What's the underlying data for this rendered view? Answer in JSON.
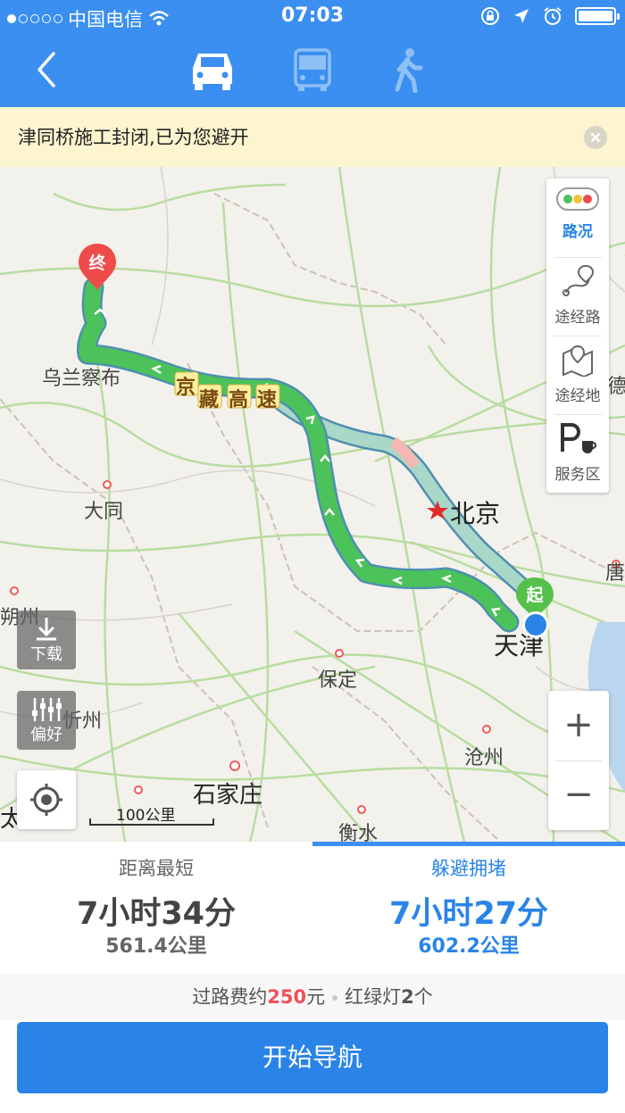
{
  "status_bar": {
    "carrier": "中国电信",
    "time": "07:03"
  },
  "navbar": {
    "modes": [
      "car-icon",
      "bus-icon",
      "walk-icon"
    ],
    "selected_mode": "car"
  },
  "notice": {
    "text": "津同桥施工封闭,已为您避开"
  },
  "map": {
    "cities": {
      "wulanchabu": "乌兰察布",
      "datong": "大同",
      "beijing": "北京",
      "tianjin": "天津",
      "baoding": "保定",
      "cangzhou": "沧州",
      "shijiazhuang": "石家庄",
      "hengshui": "衡水",
      "shuozhou": "朔州",
      "xinzhou": "忻州",
      "tangshan": "唐",
      "dezhou": "德",
      "taiyuan": "太"
    },
    "highway_label": [
      "京",
      "藏",
      "高",
      "速"
    ],
    "start_label": "起",
    "end_label": "终",
    "sidebar": {
      "traffic": "路况",
      "via_road": "途经路",
      "via_place": "途经地",
      "service": "服务区"
    },
    "download": "下载",
    "preference": "偏好",
    "scale": "100公里",
    "zoom_in": "+",
    "zoom_out": "−"
  },
  "routes": [
    {
      "name": "距离最短",
      "time": "7小时34分",
      "distance": "561.4公里",
      "selected": false
    },
    {
      "name": "躲避拥堵",
      "time": "7小时27分",
      "distance": "602.2公里",
      "selected": true
    }
  ],
  "fees": {
    "toll_prefix": "过路费约",
    "toll_value": "250",
    "toll_suffix": "元",
    "lights_prefix": "红绿灯",
    "lights_value": "2",
    "lights_suffix": "个"
  },
  "start_button": "开始导航",
  "colors": {
    "brand_blue": "#3a8ff0",
    "route_green": "#4cc25a",
    "alt_route": "#a9d8c8",
    "notice_bg": "#fdf5cf",
    "end_pin": "#ee4b4b",
    "start_pin": "#55c04a"
  }
}
